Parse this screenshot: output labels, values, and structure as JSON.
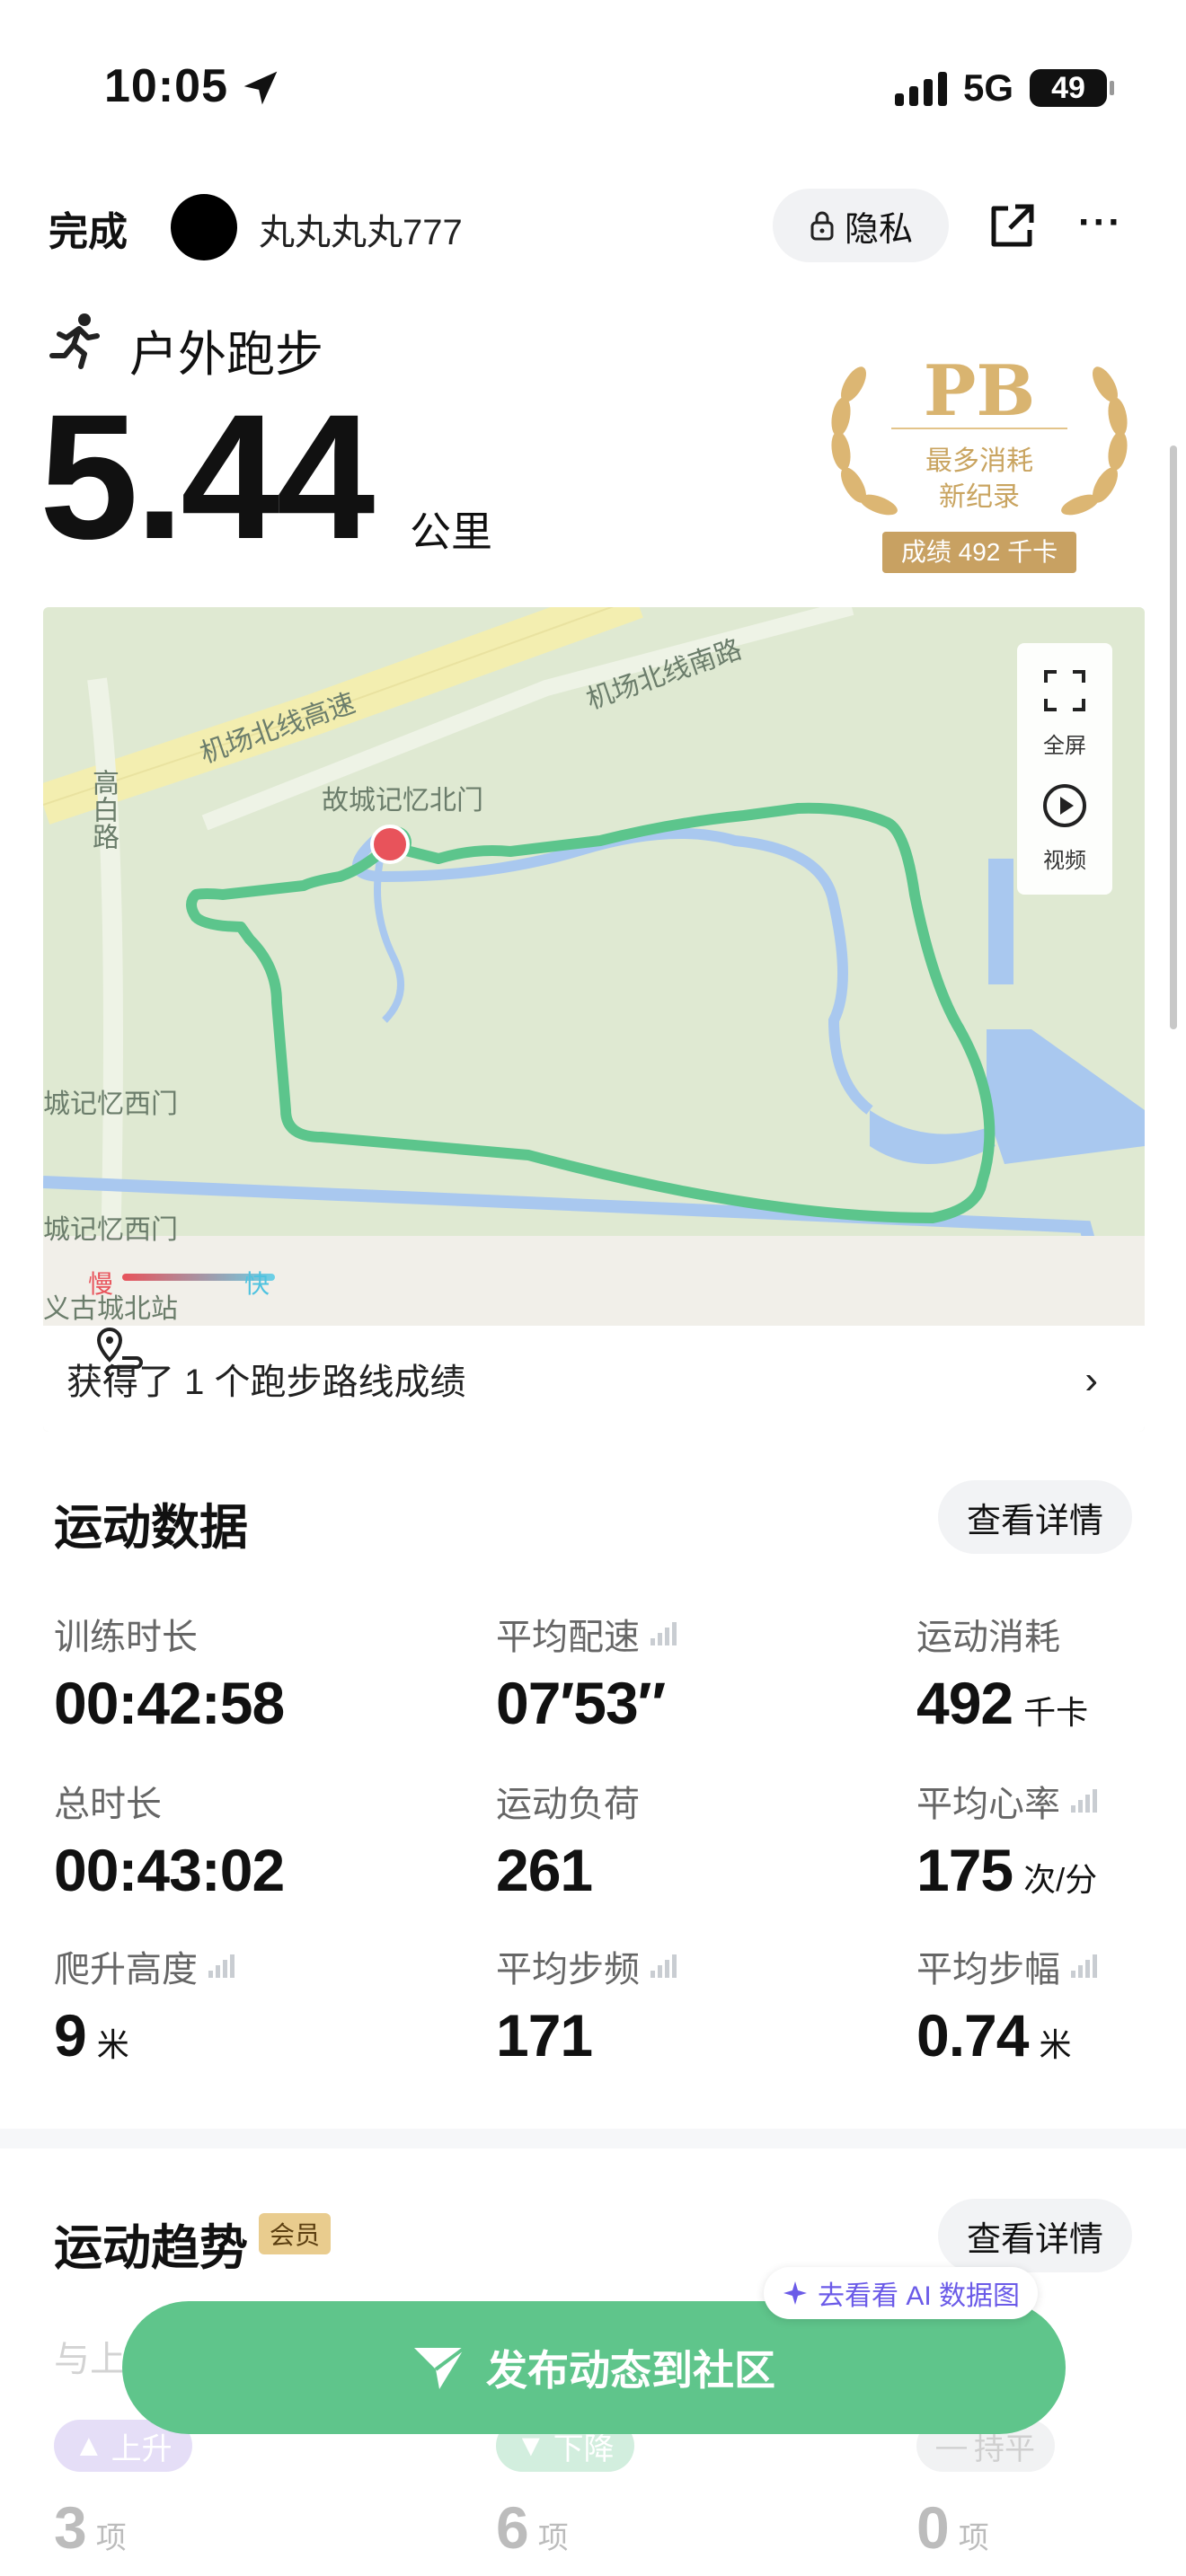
{
  "status_bar": {
    "time": "10:05",
    "network": "5G",
    "battery": "49"
  },
  "nav": {
    "done_label": "完成",
    "username": "丸丸丸丸777",
    "privacy_label": "隐私"
  },
  "activity": {
    "type": "户外跑步",
    "distance": "5.44",
    "distance_unit": "公里"
  },
  "pb_badge": {
    "title": "PB",
    "line1": "最多消耗",
    "line2": "新纪录",
    "record": "成绩 492 千卡"
  },
  "map": {
    "labels": {
      "road1": "机场北线高速",
      "road2": "机场北线南路",
      "road3": "高白路",
      "gate_north": "故城记忆北门",
      "gate_west1": "城记忆西门",
      "gate_west2": "城记忆西门",
      "station": "义古城北站"
    },
    "controls": {
      "fullscreen": "全屏",
      "video": "视频"
    },
    "legend": {
      "slow": "慢",
      "fast": "快"
    },
    "achievement": "获得了 1 个跑步路线成绩",
    "route_color": "#5cc58c",
    "start_color": "#e8535b"
  },
  "sport_data": {
    "title": "运动数据",
    "detail_btn": "查看详情",
    "stats": [
      {
        "label": "训练时长",
        "value": "00:42:58",
        "unit": ""
      },
      {
        "label": "平均配速",
        "value": "07′53″",
        "unit": ""
      },
      {
        "label": "运动消耗",
        "value": "492",
        "unit": "千卡"
      },
      {
        "label": "总时长",
        "value": "00:43:02",
        "unit": ""
      },
      {
        "label": "运动负荷",
        "value": "261",
        "unit": ""
      },
      {
        "label": "平均心率",
        "value": "175",
        "unit": "次/分"
      },
      {
        "label": "爬升高度",
        "value": "9",
        "unit": "米"
      },
      {
        "label": "平均步频",
        "value": "171",
        "unit": ""
      },
      {
        "label": "平均步幅",
        "value": "0.74",
        "unit": "米"
      }
    ]
  },
  "trend": {
    "title": "运动趋势",
    "member_badge": "会员",
    "detail_btn": "查看详情",
    "ai_label": "去看看 AI 数据图",
    "compare_prefix": "与上",
    "up": {
      "label": "上升",
      "count": "3",
      "unit": "项",
      "color": "#a48be6"
    },
    "down": {
      "label": "下降",
      "count": "6",
      "unit": "项",
      "color": "#5fc58b"
    },
    "flat": {
      "label": "持平",
      "count": "0",
      "unit": "项",
      "color": "#cfd2d6"
    }
  },
  "publish_btn": "发布动态到社区"
}
